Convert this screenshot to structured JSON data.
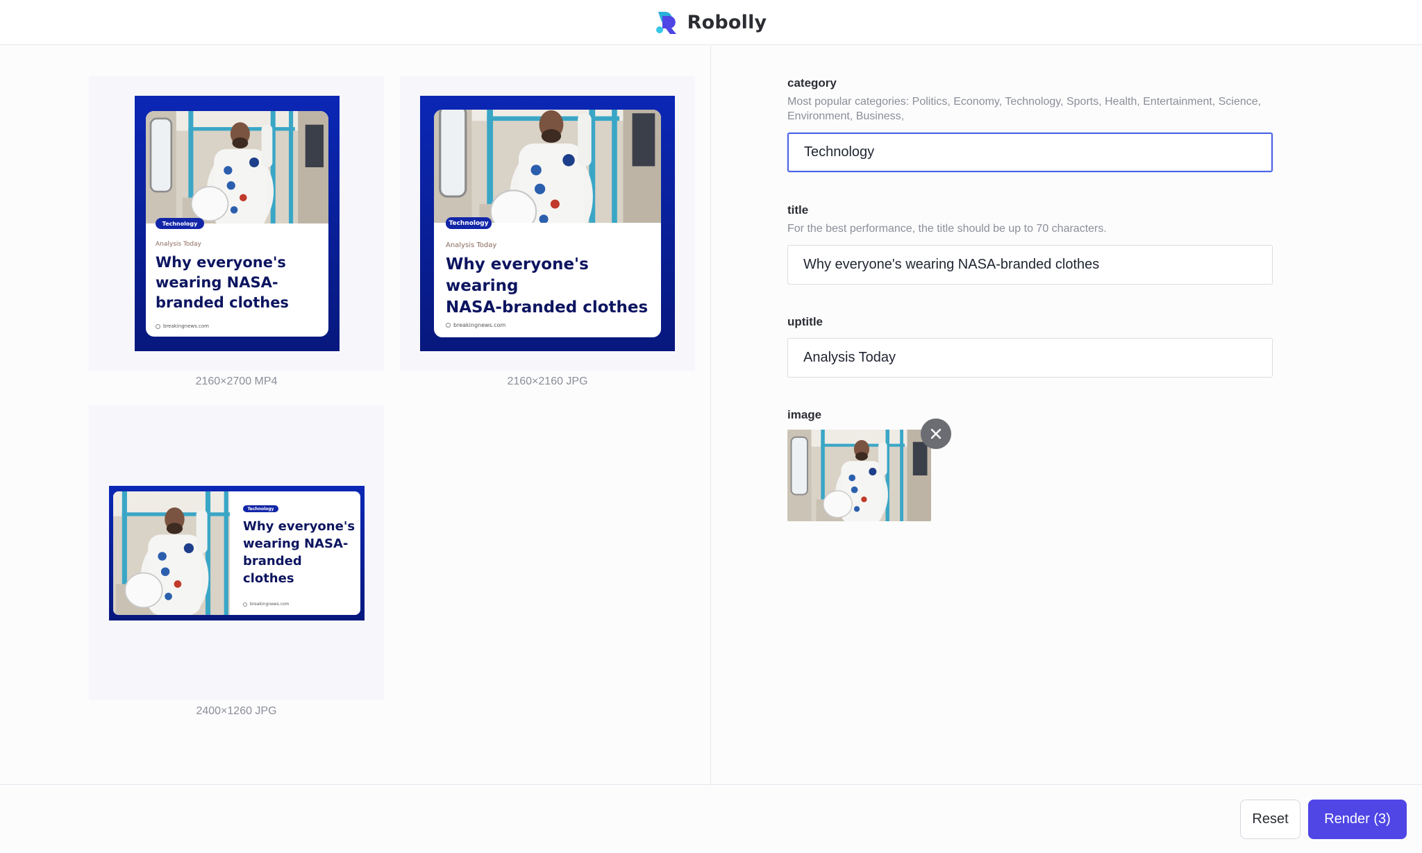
{
  "app": {
    "brand": "Robolly"
  },
  "previews": [
    {
      "format_label": "2160×2700 MP4",
      "category": "Technology",
      "uptitle": "Analysis Today",
      "headline_lines": [
        "Why everyone's",
        "wearing NASA-",
        "branded clothes"
      ],
      "site": "breakingnews.com"
    },
    {
      "format_label": "2160×2160 JPG",
      "category": "Technology",
      "uptitle": "Analysis Today",
      "headline_lines": [
        "Why everyone's wearing",
        "NASA-branded clothes"
      ],
      "site": "breakingnews.com"
    },
    {
      "format_label": "2400×1260 JPG",
      "category": "Technology",
      "headline_lines": [
        "Why everyone's",
        "wearing NASA-",
        "branded",
        "clothes"
      ],
      "site": "breakingnews.com"
    }
  ],
  "form": {
    "category": {
      "label": "category",
      "help": "Most popular categories: Politics, Economy, Technology, Sports, Health, Entertainment, Science, Environment, Business,",
      "value": "Technology"
    },
    "title": {
      "label": "title",
      "help": "For the best performance, the title should be up to 70 characters.",
      "value": "Why everyone's wearing NASA-branded clothes"
    },
    "uptitle": {
      "label": "uptitle",
      "value": "Analysis Today"
    },
    "image": {
      "label": "image"
    }
  },
  "footer": {
    "reset_label": "Reset",
    "render_label": "Render (3)"
  },
  "colors": {
    "accent": "#4f46e5",
    "poster_blue": "#0b27b5",
    "headline_navy": "#0d1560"
  }
}
